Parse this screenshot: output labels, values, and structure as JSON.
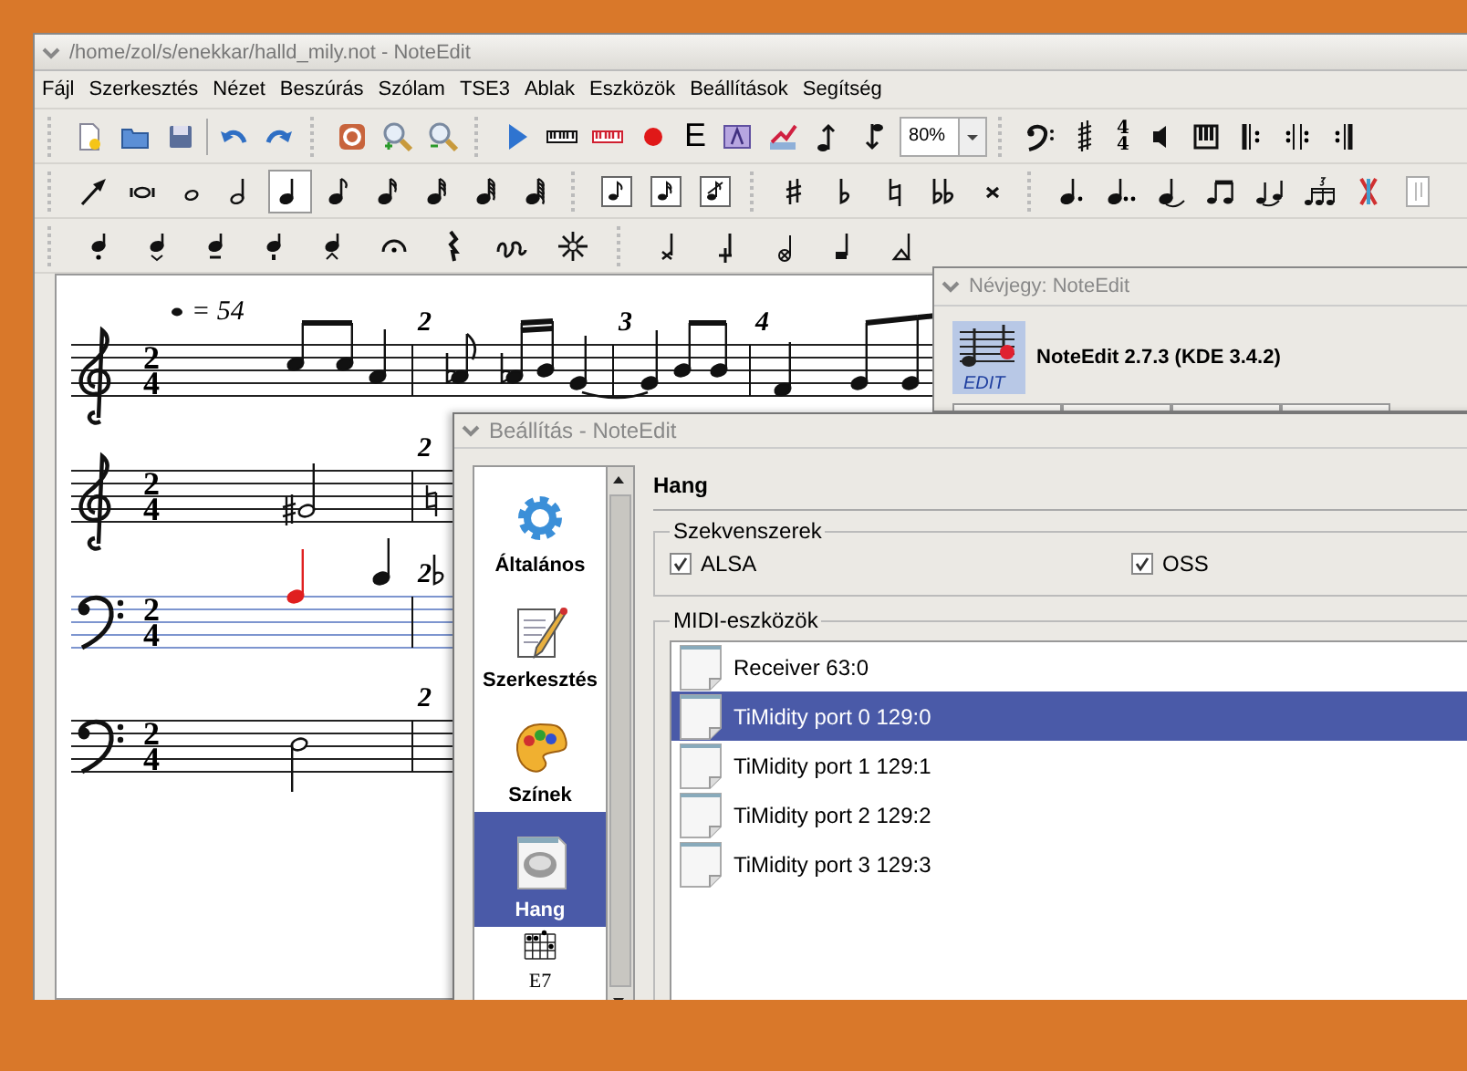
{
  "main_window": {
    "title": "/home/zol/s/enekkar/halld_mily.not - NoteEdit",
    "menu": [
      {
        "label": "Fájl"
      },
      {
        "label": "Szerkesztés"
      },
      {
        "label": "Nézet"
      },
      {
        "label": "Beszúrás"
      },
      {
        "label": "Szólam"
      },
      {
        "label": "TSE3"
      },
      {
        "label": "Ablak"
      },
      {
        "label": "Eszközök"
      },
      {
        "label": "Beállítások"
      },
      {
        "label": "Segítség"
      }
    ],
    "toolbar": {
      "letter_button": "E",
      "zoom_combo": "80%",
      "time_signature": [
        "4",
        "4"
      ],
      "duration_tools": [
        {
          "selected": false
        },
        {
          "selected": false
        },
        {
          "selected": false
        },
        {
          "selected": true
        },
        {
          "selected": false
        },
        {
          "selected": false
        },
        {
          "selected": false
        },
        {
          "selected": false
        },
        {
          "selected": false
        }
      ]
    },
    "score": {
      "tempo": "= 54",
      "staves": [
        {
          "kind": "treble",
          "time": [
            "2",
            "4"
          ],
          "selected": false,
          "measure_numbers": [
            "2",
            "3",
            "4"
          ]
        },
        {
          "kind": "treble",
          "time": [
            "2",
            "4"
          ],
          "selected": false,
          "measure_numbers": [
            "2"
          ]
        },
        {
          "kind": "bass",
          "time": [
            "2",
            "4"
          ],
          "selected": true,
          "measure_numbers": [
            "2"
          ]
        },
        {
          "kind": "bass",
          "time": [
            "2",
            "4"
          ],
          "selected": false,
          "measure_numbers": [
            "2"
          ]
        }
      ]
    }
  },
  "about_dialog": {
    "title": "Névjegy: NoteEdit",
    "logo_text": "EDIT",
    "app_name": "NoteEdit 2.7.3 (KDE 3.4.2)"
  },
  "settings_dialog": {
    "title": "Beállítás - NoteEdit",
    "pages": [
      {
        "label": "Általános",
        "selected": false
      },
      {
        "label": "Szerkesztés",
        "selected": false
      },
      {
        "label": "Színek",
        "selected": false
      },
      {
        "label": "Hang",
        "selected": true
      },
      {
        "label": "E7",
        "selected": false
      }
    ],
    "heading": "Hang",
    "sequencers": {
      "title": "Szekvenszerek",
      "options": [
        {
          "label": "ALSA",
          "checked": true
        },
        {
          "label": "OSS",
          "checked": true
        }
      ]
    },
    "midi_devices": {
      "title": "MIDI-eszközök",
      "items": [
        {
          "label": "Receiver 63:0",
          "selected": false
        },
        {
          "label": "TiMidity port 0 129:0",
          "selected": true
        },
        {
          "label": "TiMidity port 1 129:1",
          "selected": false
        },
        {
          "label": "TiMidity port 2 129:2",
          "selected": false
        },
        {
          "label": "TiMidity port 3 129:3",
          "selected": false
        }
      ]
    }
  }
}
